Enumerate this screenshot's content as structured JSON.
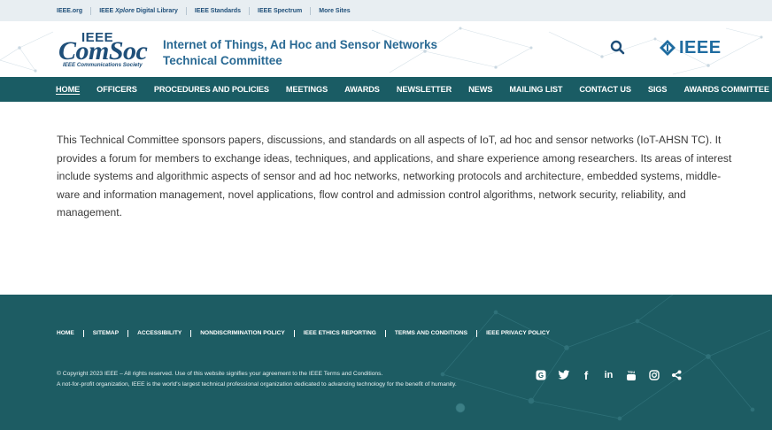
{
  "util_bar": {
    "links": [
      {
        "pre": "IEEE.org",
        "italic": "",
        "post": ""
      },
      {
        "pre": "IEEE ",
        "italic": "Xplore",
        "post": " Digital Library"
      },
      {
        "pre": "IEEE Standards",
        "italic": "",
        "post": ""
      },
      {
        "pre": "IEEE Spectrum",
        "italic": "",
        "post": ""
      },
      {
        "pre": "More Sites",
        "italic": "",
        "post": ""
      }
    ]
  },
  "header": {
    "logo": {
      "top_word": "IEEE",
      "main_word": "ComSoc",
      "sub_word": "IEEE Communications Society"
    },
    "title_line1": "Internet of Things, Ad Hoc and Sensor Networks",
    "title_line2": "Technical Committee",
    "search_icon": "search-icon",
    "ieee_logo_text": "IEEE",
    "colors": {
      "brand": "#1f4f79",
      "title": "#2a6a94",
      "nav": "#1a5c64",
      "footer": "#1d5c63"
    }
  },
  "nav": {
    "items": [
      {
        "label": "HOME",
        "active": true
      },
      {
        "label": "OFFICERS",
        "active": false
      },
      {
        "label": "PROCEDURES AND POLICIES",
        "active": false
      },
      {
        "label": "MEETINGS",
        "active": false
      },
      {
        "label": "AWARDS",
        "active": false
      },
      {
        "label": "NEWSLETTER",
        "active": false
      },
      {
        "label": "NEWS",
        "active": false
      },
      {
        "label": "MAILING LIST",
        "active": false
      },
      {
        "label": "CONTACT US",
        "active": false
      },
      {
        "label": "SIGS",
        "active": false
      },
      {
        "label": "AWARDS COMMITTEE",
        "active": false
      }
    ]
  },
  "main": {
    "intro": "This Technical Committee sponsors papers, discussions, and standards on all aspects of IoT, ad hoc and sensor networks (IoT-AHSN TC). It provides a forum for members to exchange ideas, techniques, and applications, and share experience among researchers. Its areas of interest include systems and algorithmic aspects of sensor and ad hoc networks, networking protocols and architecture, embedded systems, middle-ware and information management, novel applications, flow control and admission control algorithms, network security, reliability, and management."
  },
  "footer": {
    "links": [
      "HOME",
      "SITEMAP",
      "ACCESSIBILITY",
      "NONDISCRIMINATION POLICY",
      "IEEE ETHICS REPORTING",
      "TERMS AND CONDITIONS",
      "IEEE PRIVACY POLICY"
    ],
    "copyright_line1": "© Copyright 2023 IEEE – All rights reserved. Use of this website signifies your agreement to the IEEE Terms and Conditions.",
    "copyright_line2": "A not-for-profit organization, IEEE is the world's largest technical professional organization dedicated to advancing technology for the benefit of humanity.",
    "social": [
      {
        "name": "google-icon",
        "glyph": "G"
      },
      {
        "name": "twitter-icon",
        "glyph": ""
      },
      {
        "name": "facebook-icon",
        "glyph": "f"
      },
      {
        "name": "linkedin-icon",
        "glyph": "in"
      },
      {
        "name": "youtube-icon",
        "glyph": "You"
      },
      {
        "name": "instagram-icon",
        "glyph": ""
      },
      {
        "name": "share-icon",
        "glyph": ""
      }
    ]
  }
}
